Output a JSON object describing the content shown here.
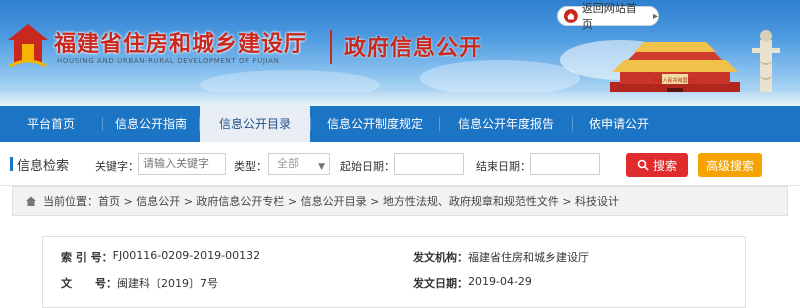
{
  "header": {
    "title_cn": "福建省住房和城乡建设厅",
    "title_en": "HOUSING AND URBAN-RURAL DEVELOPMENT OF FUJIAN",
    "section_title": "政府信息公开",
    "return_link": "返回网站首页",
    "banner_sign": "中华人民共和国万岁"
  },
  "nav": {
    "items": [
      {
        "label": "平台首页"
      },
      {
        "label": "信息公开指南"
      },
      {
        "label": "信息公开目录"
      },
      {
        "label": "信息公开制度规定"
      },
      {
        "label": "信息公开年度报告"
      },
      {
        "label": "依申请公开"
      }
    ],
    "active_index": 2
  },
  "search": {
    "title": "信息检索",
    "keyword_label": "关键字：",
    "keyword_placeholder": "请输入关键字",
    "type_label": "类型：",
    "type_value": "全部",
    "start_label": "起始日期：",
    "end_label": "结束日期：",
    "search_button": "搜索",
    "advanced_button": "高级搜索"
  },
  "breadcrumb": {
    "text": "当前位置：首页 > 信息公开 > 政府信息公开专栏 > 信息公开目录 > 地方性法规、政府规章和规范性文件 > 科技设计"
  },
  "info": {
    "index_label": "索 引 号：",
    "index_value": "FJ00116-0209-2019-00132",
    "org_label": "发文机构：",
    "org_value": "福建省住房和城乡建设厅",
    "doc_label": "文      号：",
    "doc_value": "闽建科〔2019〕7号",
    "date_label": "发文日期：",
    "date_value": "2019-04-29"
  },
  "colors": {
    "nav_bg": "#1c74c4",
    "title_red": "#c8281d",
    "search_btn": "#e02c2c",
    "advanced_btn": "#f5a300"
  }
}
